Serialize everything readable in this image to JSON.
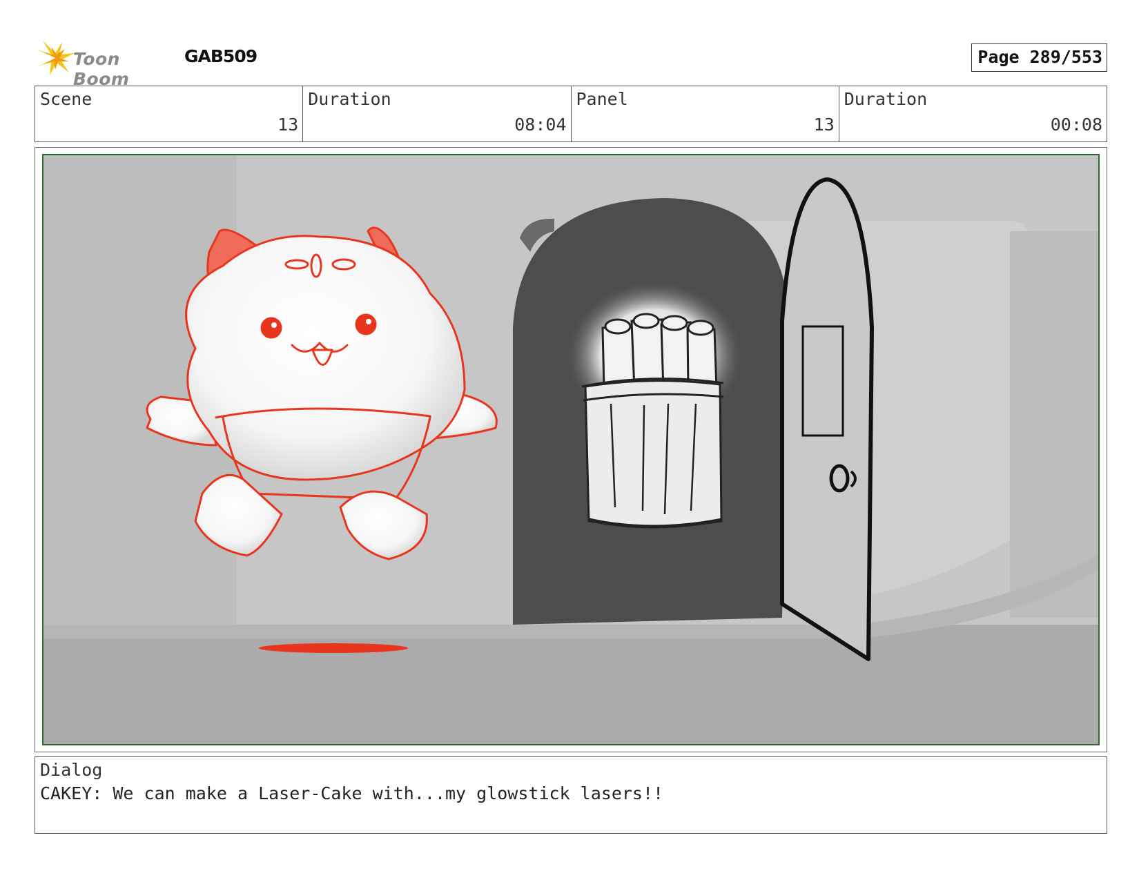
{
  "header": {
    "logo_text": "Toon Boom",
    "project": "GAB509",
    "page": "Page 289/553"
  },
  "info": {
    "scene_label": "Scene",
    "scene_value": "13",
    "scene_duration_label": "Duration",
    "scene_duration_value": "08:04",
    "panel_label": "Panel",
    "panel_value": "13",
    "panel_duration_label": "Duration",
    "panel_duration_value": "00:08"
  },
  "dialog": {
    "label": "Dialog",
    "text": "CAKEY: We can make a Laser-Cake with...my glowstick lasers!!"
  },
  "colors": {
    "sketch_red": "#e8361e",
    "panel_border": "#2e6b2e",
    "background_gray": "#c4c4c4",
    "door_dark": "#4d4d4d"
  }
}
